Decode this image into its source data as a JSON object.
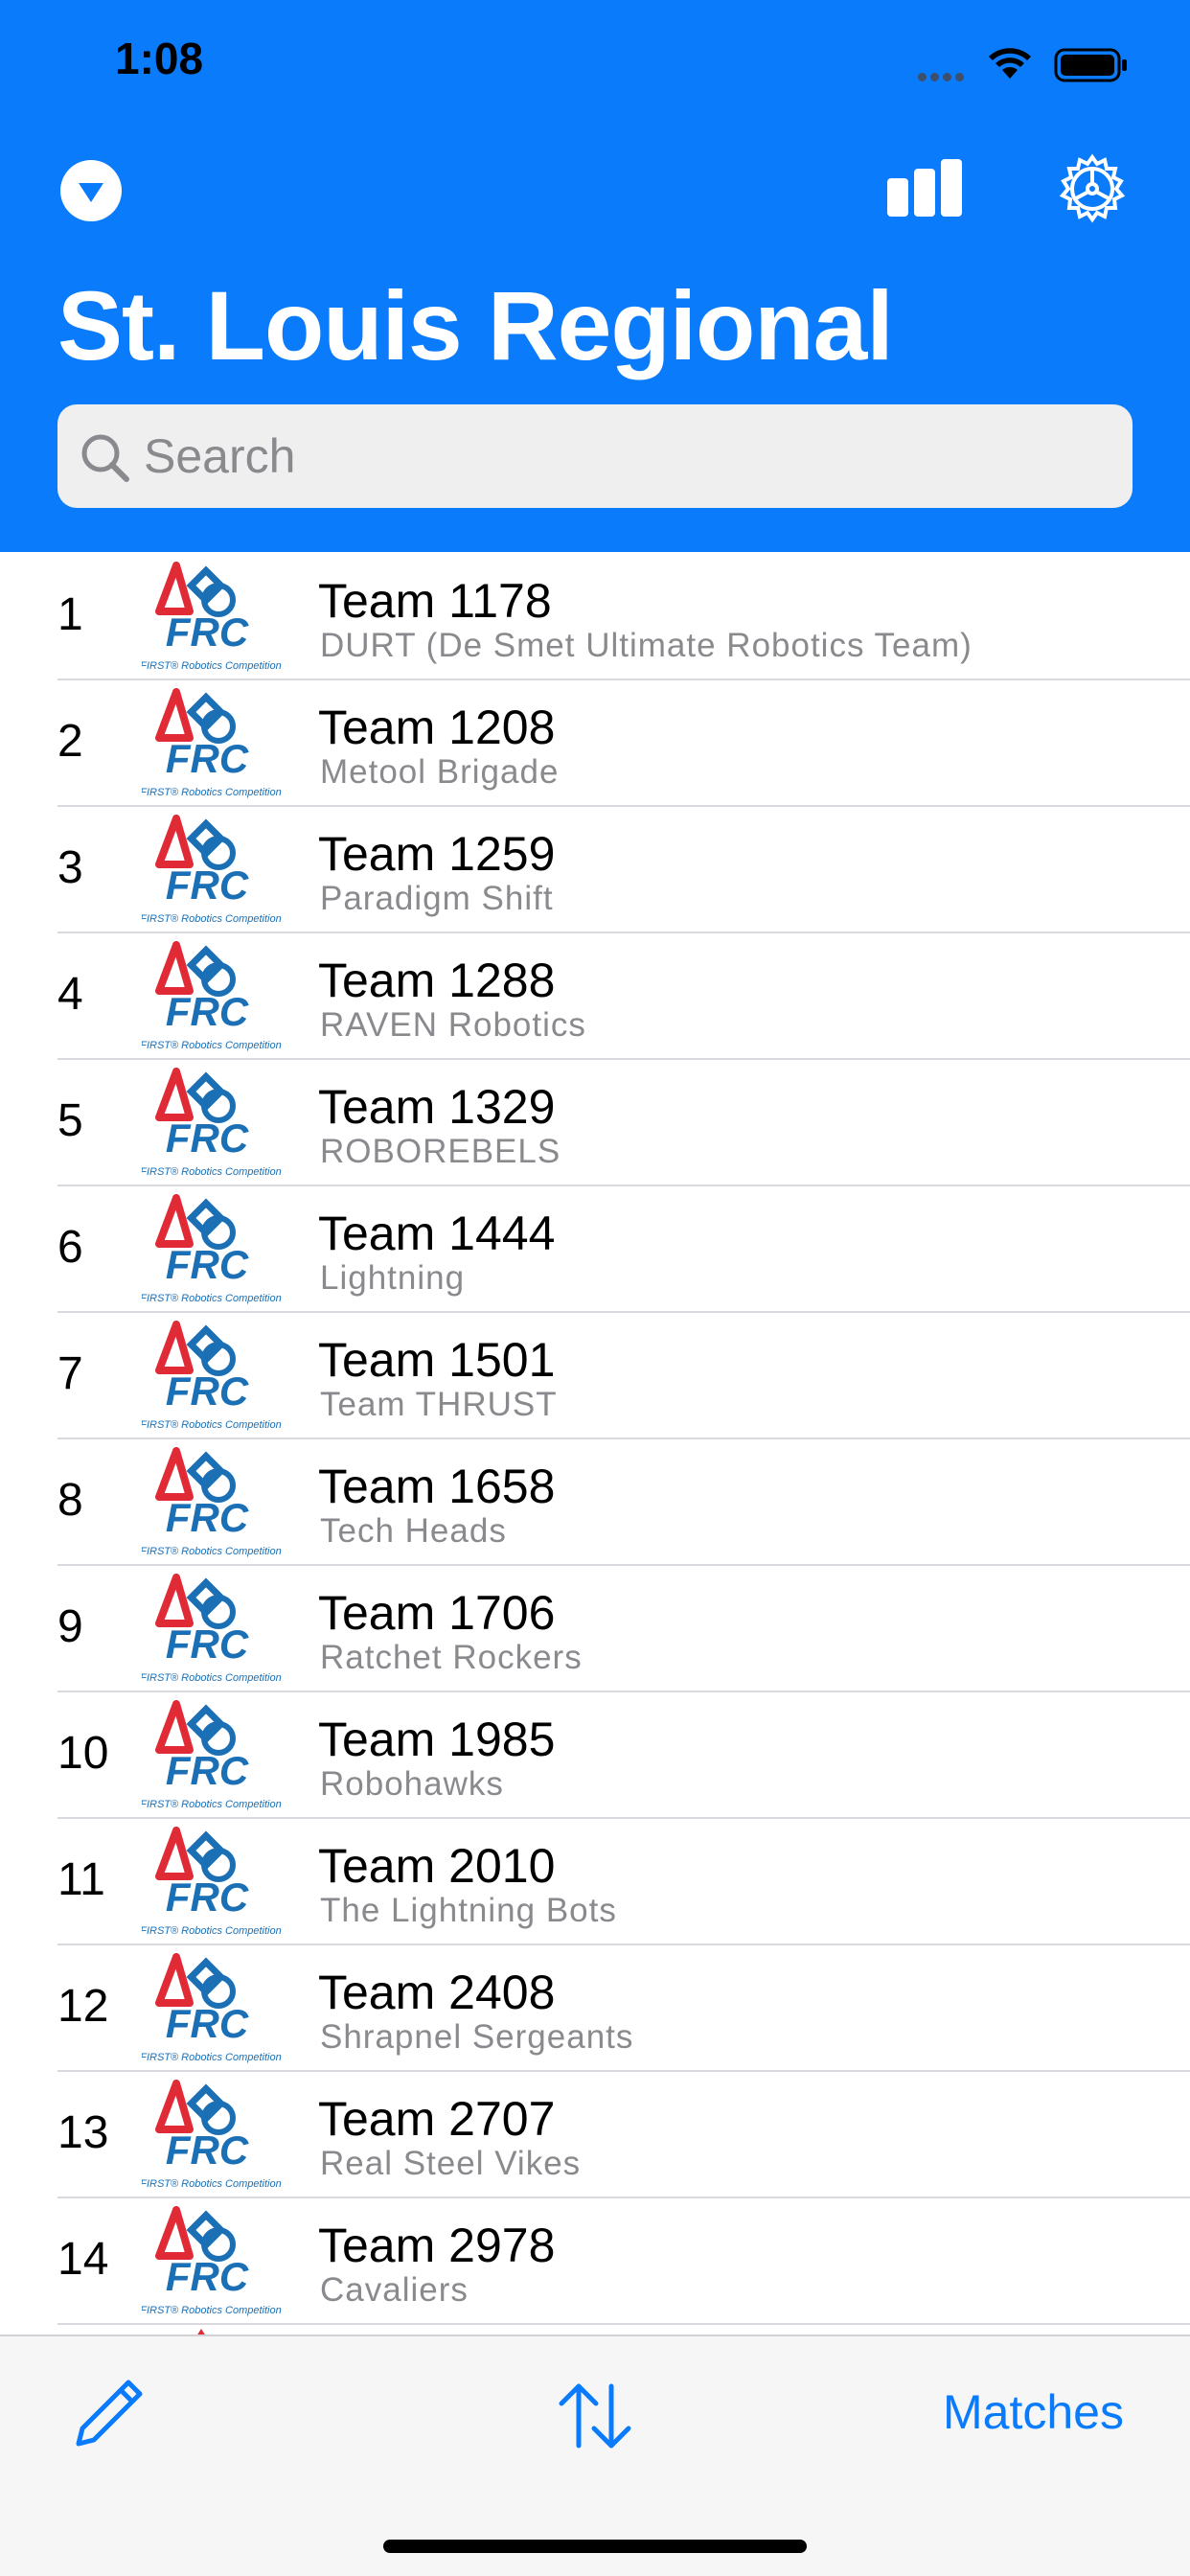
{
  "status_bar": {
    "time": "1:08"
  },
  "header": {
    "title": "St. Louis Regional",
    "search_placeholder": "Search",
    "accent_color": "#0a7bfb",
    "icons": [
      "chevron-down-circle-icon",
      "bar-chart-icon",
      "gear-icon"
    ]
  },
  "teams": [
    {
      "rank": "1",
      "name": "Team 1178",
      "nickname": "DURT  (De Smet Ultimate Robotics Team)"
    },
    {
      "rank": "2",
      "name": "Team 1208",
      "nickname": "Metool Brigade"
    },
    {
      "rank": "3",
      "name": "Team 1259",
      "nickname": "Paradigm Shift"
    },
    {
      "rank": "4",
      "name": "Team 1288",
      "nickname": "RAVEN Robotics"
    },
    {
      "rank": "5",
      "name": "Team 1329",
      "nickname": "ROBOREBELS"
    },
    {
      "rank": "6",
      "name": "Team 1444",
      "nickname": "Lightning"
    },
    {
      "rank": "7",
      "name": "Team 1501",
      "nickname": "Team THRUST"
    },
    {
      "rank": "8",
      "name": "Team 1658",
      "nickname": "Tech Heads"
    },
    {
      "rank": "9",
      "name": "Team 1706",
      "nickname": "Ratchet Rockers"
    },
    {
      "rank": "10",
      "name": "Team 1985",
      "nickname": "Robohawks"
    },
    {
      "rank": "11",
      "name": "Team 2010",
      "nickname": "The Lightning Bots"
    },
    {
      "rank": "12",
      "name": "Team 2408",
      "nickname": "Shrapnel Sergeants"
    },
    {
      "rank": "13",
      "name": "Team 2707",
      "nickname": "Real  Steel Vikes"
    },
    {
      "rank": "14",
      "name": "Team 2978",
      "nickname": "Cavaliers"
    }
  ],
  "logo": {
    "text": "FRC",
    "caption": "FIRST® Robotics Competition"
  },
  "toolbar": {
    "matches_label": "Matches",
    "icons": [
      "pencil-icon",
      "sort-arrows-icon"
    ]
  }
}
